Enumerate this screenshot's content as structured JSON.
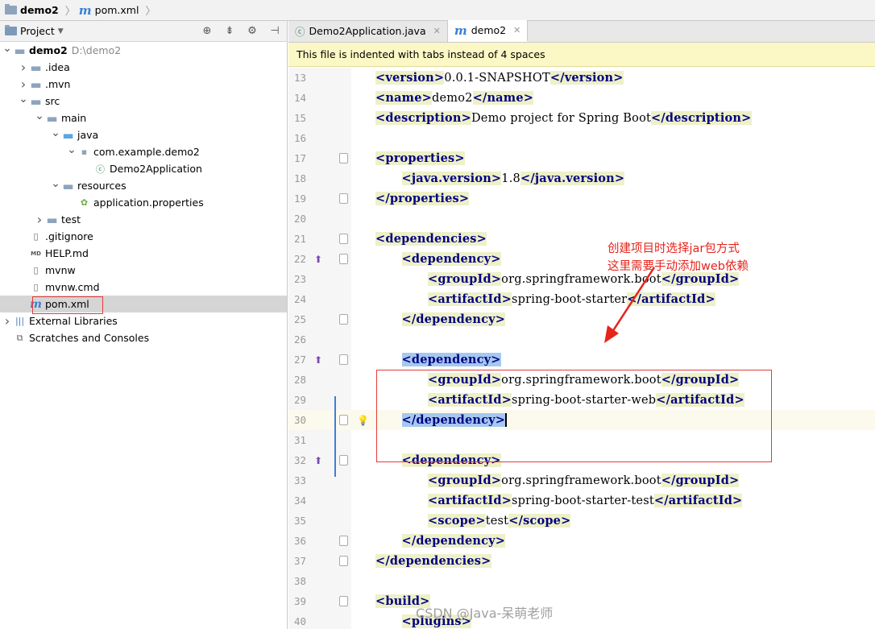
{
  "breadcrumb": {
    "project": "demo2",
    "file": "pom.xml"
  },
  "project_panel": {
    "title": "Project",
    "tree": [
      {
        "label": "demo2",
        "path": "D:\\demo2",
        "level": 0,
        "arrow": "down",
        "icon": "folder",
        "bold": true
      },
      {
        "label": ".idea",
        "level": 1,
        "arrow": "right",
        "icon": "folder"
      },
      {
        "label": ".mvn",
        "level": 1,
        "arrow": "right",
        "icon": "folder"
      },
      {
        "label": "src",
        "level": 1,
        "arrow": "down",
        "icon": "folder"
      },
      {
        "label": "main",
        "level": 2,
        "arrow": "down",
        "icon": "folder"
      },
      {
        "label": "java",
        "level": 3,
        "arrow": "down",
        "icon": "source-folder"
      },
      {
        "label": "com.example.demo2",
        "level": 4,
        "arrow": "down",
        "icon": "package"
      },
      {
        "label": "Demo2Application",
        "level": 5,
        "arrow": "",
        "icon": "spring-class"
      },
      {
        "label": "resources",
        "level": 3,
        "arrow": "down",
        "icon": "resources-folder"
      },
      {
        "label": "application.properties",
        "level": 4,
        "arrow": "",
        "icon": "properties"
      },
      {
        "label": "test",
        "level": 2,
        "arrow": "right",
        "icon": "folder"
      },
      {
        "label": ".gitignore",
        "level": 1,
        "arrow": "",
        "icon": "file"
      },
      {
        "label": "HELP.md",
        "level": 1,
        "arrow": "",
        "icon": "markdown"
      },
      {
        "label": "mvnw",
        "level": 1,
        "arrow": "",
        "icon": "file"
      },
      {
        "label": "mvnw.cmd",
        "level": 1,
        "arrow": "",
        "icon": "file"
      },
      {
        "label": "pom.xml",
        "level": 1,
        "arrow": "",
        "icon": "maven",
        "selected": true
      },
      {
        "label": "External Libraries",
        "level": 0,
        "arrow": "right",
        "icon": "libraries"
      },
      {
        "label": "Scratches and Consoles",
        "level": 0,
        "arrow": "",
        "icon": "scratches"
      }
    ]
  },
  "tabs": [
    {
      "label": "Demo2Application.java",
      "icon": "spring-class",
      "active": false
    },
    {
      "label": "demo2",
      "icon": "maven",
      "active": true
    }
  ],
  "banner": "This file is indented with tabs instead of 4 spaces",
  "annotation": {
    "line1": "创建项目时选择jar包方式",
    "line2": "这里需要手动添加web依赖"
  },
  "watermark": "CSDN @Java-呆萌老师",
  "code_lines": [
    {
      "n": "13",
      "indent": 1,
      "parts": [
        [
          "t",
          "<version>"
        ],
        [
          "v",
          "0.0.1-SNAPSHOT"
        ],
        [
          "t",
          "</version>"
        ]
      ]
    },
    {
      "n": "14",
      "indent": 1,
      "parts": [
        [
          "t",
          "<name>"
        ],
        [
          "v",
          "demo2"
        ],
        [
          "t",
          "</name>"
        ]
      ]
    },
    {
      "n": "15",
      "indent": 1,
      "parts": [
        [
          "t",
          "<description>"
        ],
        [
          "v",
          "Demo project for Spring Boot"
        ],
        [
          "t",
          "</description>"
        ]
      ]
    },
    {
      "n": "16",
      "indent": 0,
      "parts": []
    },
    {
      "n": "17",
      "indent": 1,
      "fold": true,
      "parts": [
        [
          "t",
          "<properties>"
        ]
      ]
    },
    {
      "n": "18",
      "indent": 2,
      "parts": [
        [
          "t",
          "<java.version>"
        ],
        [
          "v",
          "1.8"
        ],
        [
          "t",
          "</java.version>"
        ]
      ]
    },
    {
      "n": "19",
      "indent": 1,
      "fold": true,
      "parts": [
        [
          "t",
          "</properties>"
        ]
      ]
    },
    {
      "n": "20",
      "indent": 0,
      "parts": []
    },
    {
      "n": "21",
      "indent": 1,
      "fold": true,
      "parts": [
        [
          "t",
          "<dependencies>"
        ]
      ]
    },
    {
      "n": "22",
      "indent": 2,
      "fold": true,
      "gicon": true,
      "parts": [
        [
          "t",
          "<dependency>"
        ]
      ]
    },
    {
      "n": "23",
      "indent": 3,
      "parts": [
        [
          "t",
          "<groupId>"
        ],
        [
          "v",
          "org.springframework.boot"
        ],
        [
          "t",
          "</groupId>"
        ]
      ]
    },
    {
      "n": "24",
      "indent": 3,
      "parts": [
        [
          "t",
          "<artifactId>"
        ],
        [
          "v",
          "spring-boot-starter"
        ],
        [
          "t",
          "</artifactId>"
        ]
      ]
    },
    {
      "n": "25",
      "indent": 2,
      "fold": true,
      "parts": [
        [
          "t",
          "</dependency>"
        ]
      ]
    },
    {
      "n": "26",
      "indent": 0,
      "parts": []
    },
    {
      "n": "27",
      "indent": 2,
      "fold": true,
      "gicon": true,
      "parts": [
        [
          "s",
          "<dependency>"
        ]
      ]
    },
    {
      "n": "28",
      "indent": 3,
      "parts": [
        [
          "t",
          "<groupId>"
        ],
        [
          "v",
          "org.springframework.boot"
        ],
        [
          "t",
          "</groupId>"
        ]
      ]
    },
    {
      "n": "29",
      "indent": 3,
      "parts": [
        [
          "t",
          "<artifactId>"
        ],
        [
          "v",
          "spring-boot-starter-web"
        ],
        [
          "t",
          "</artifactId>"
        ]
      ]
    },
    {
      "n": "30",
      "indent": 2,
      "fold": true,
      "bulb": true,
      "current": true,
      "parts": [
        [
          "s",
          "</dependency>"
        ],
        [
          "c",
          ""
        ]
      ]
    },
    {
      "n": "31",
      "indent": 0,
      "parts": []
    },
    {
      "n": "32",
      "indent": 2,
      "fold": true,
      "gicon": true,
      "parts": [
        [
          "t",
          "<dependency>"
        ]
      ]
    },
    {
      "n": "33",
      "indent": 3,
      "parts": [
        [
          "t",
          "<groupId>"
        ],
        [
          "v",
          "org.springframework.boot"
        ],
        [
          "t",
          "</groupId>"
        ]
      ]
    },
    {
      "n": "34",
      "indent": 3,
      "parts": [
        [
          "t",
          "<artifactId>"
        ],
        [
          "v",
          "spring-boot-starter-test"
        ],
        [
          "t",
          "</artifactId>"
        ]
      ]
    },
    {
      "n": "35",
      "indent": 3,
      "parts": [
        [
          "t",
          "<scope>"
        ],
        [
          "v",
          "test"
        ],
        [
          "t",
          "</scope>"
        ]
      ]
    },
    {
      "n": "36",
      "indent": 2,
      "fold": true,
      "parts": [
        [
          "t",
          "</dependency>"
        ]
      ]
    },
    {
      "n": "37",
      "indent": 1,
      "fold": true,
      "parts": [
        [
          "t",
          "</dependencies>"
        ]
      ]
    },
    {
      "n": "38",
      "indent": 0,
      "parts": []
    },
    {
      "n": "39",
      "indent": 1,
      "fold": true,
      "parts": [
        [
          "t",
          "<build>"
        ]
      ]
    },
    {
      "n": "40",
      "indent": 2,
      "parts": [
        [
          "t",
          "<plugins>"
        ]
      ]
    }
  ]
}
